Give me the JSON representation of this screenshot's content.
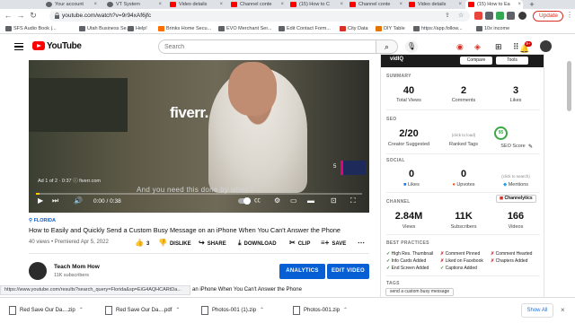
{
  "browser": {
    "tabs": [
      {
        "label": "Your account",
        "favicon": "gray"
      },
      {
        "label": "VT System",
        "favicon": "gray"
      },
      {
        "label": "Video details",
        "favicon": "red"
      },
      {
        "label": "Channel conte",
        "favicon": "red"
      },
      {
        "label": "(15) How to C",
        "favicon": "red"
      },
      {
        "label": "Channel conte",
        "favicon": "red"
      },
      {
        "label": "Video details",
        "favicon": "red"
      },
      {
        "label": "(15) How to Ea",
        "favicon": "red"
      }
    ],
    "url": "youtube.com/watch?v=9r94xAf6jfc",
    "update_label": "Update",
    "bookmarks": [
      "SFS Audio Book |...",
      "Utah Business Se...",
      "Help!",
      "Brinks Home Secu...",
      "EVO Merchant Ser...",
      "Edit Contact Form...",
      "City Data",
      "DIY Table",
      "https://app.follow...",
      "10x income"
    ],
    "status_url": "https://www.youtube.com/results?search_query=Florida&sp=EiG4AQHCARtDa..."
  },
  "youtube": {
    "logo_text": "YouTube",
    "search_placeholder": "Search",
    "notification_count": "9+"
  },
  "video": {
    "brand_overlay": "fiverr.",
    "caption": "And you need this done by when?",
    "ad_info": "Ad 1 of 2 · 0:37  ⓘ  fiverr.com",
    "ad_number": "5",
    "time": "0:00 / 0:38",
    "progress_fraction": 0.0,
    "location": "FLORIDA",
    "title": "How to Easily and Quickly Send a Custom Busy Message on an iPhone When You Can't Answer the Phone",
    "meta": "40 views • Premiered Apr 5, 2022",
    "actions": {
      "likes": "3",
      "dislike": "DISLIKE",
      "share": "SHARE",
      "download": "DOWNLOAD",
      "clip": "CLIP",
      "save": "SAVE"
    },
    "channel": {
      "name": "Teach Mom How",
      "subs": "11K subscribers"
    },
    "analytics_label": "ANALYTICS",
    "edit_label": "EDIT VIDEO",
    "description_fragment": "an iPhone When You Can't Answer the Phone"
  },
  "vidiq": {
    "header": "vidIQ",
    "compare_label": "Compare",
    "tools_label": "Tools",
    "summary": {
      "title": "SUMMARY",
      "views": "40",
      "views_label": "Total Views",
      "comments": "2",
      "comments_label": "Comments",
      "likes": "3",
      "likes_label": "Likes"
    },
    "seo": {
      "title": "SEO",
      "tags": "2/20",
      "tags_label": "Creator Suggested",
      "ranked_hint": "(click to load)",
      "ranked_label": "Ranked Tags",
      "score": "95",
      "score_label": "SEO Score"
    },
    "social": {
      "title": "SOCIAL",
      "likes": "0",
      "likes_label": "Likes",
      "upvotes": "0",
      "upvotes_label": "Upvotes",
      "mentions_hint": "(click to search)",
      "mentions_label": "Mentions"
    },
    "channel": {
      "title": "CHANNEL",
      "views": "2.84M",
      "views_label": "Views",
      "subs": "11K",
      "subs_label": "Subscribers",
      "videos": "166",
      "videos_label": "Videos",
      "channelytics_label": "Channelytics"
    },
    "best_practices": {
      "title": "BEST PRACTICES",
      "items": [
        {
          "mark": "✓",
          "ok": true,
          "text": "High Res. Thumbnail"
        },
        {
          "mark": "✗",
          "ok": false,
          "text": "Comment Pinned"
        },
        {
          "mark": "✗",
          "ok": false,
          "text": "Comment Hearted"
        },
        {
          "mark": "✓",
          "ok": true,
          "text": "Info Cards Added"
        },
        {
          "mark": "✗",
          "ok": false,
          "text": "Liked on Facebook"
        },
        {
          "mark": "✗",
          "ok": false,
          "text": "Chapters Added"
        },
        {
          "mark": "✓",
          "ok": true,
          "text": "End Screen Added"
        },
        {
          "mark": "✓",
          "ok": true,
          "text": "Captions Added"
        }
      ]
    },
    "tags": {
      "title": "TAGS",
      "first_tag": "send a custom busy message"
    }
  },
  "downloads": {
    "items": [
      "Red Save Our Da....zip",
      "Red Save Our Da....pdf",
      "Photos-001 (1).zip",
      "Photos-001.zip"
    ],
    "show_all": "Show All"
  },
  "colors": {
    "youtube_red": "#ff0000",
    "link_blue": "#065fd4",
    "seo_green": "#39a845",
    "ad_yellow": "#ffcc00"
  }
}
